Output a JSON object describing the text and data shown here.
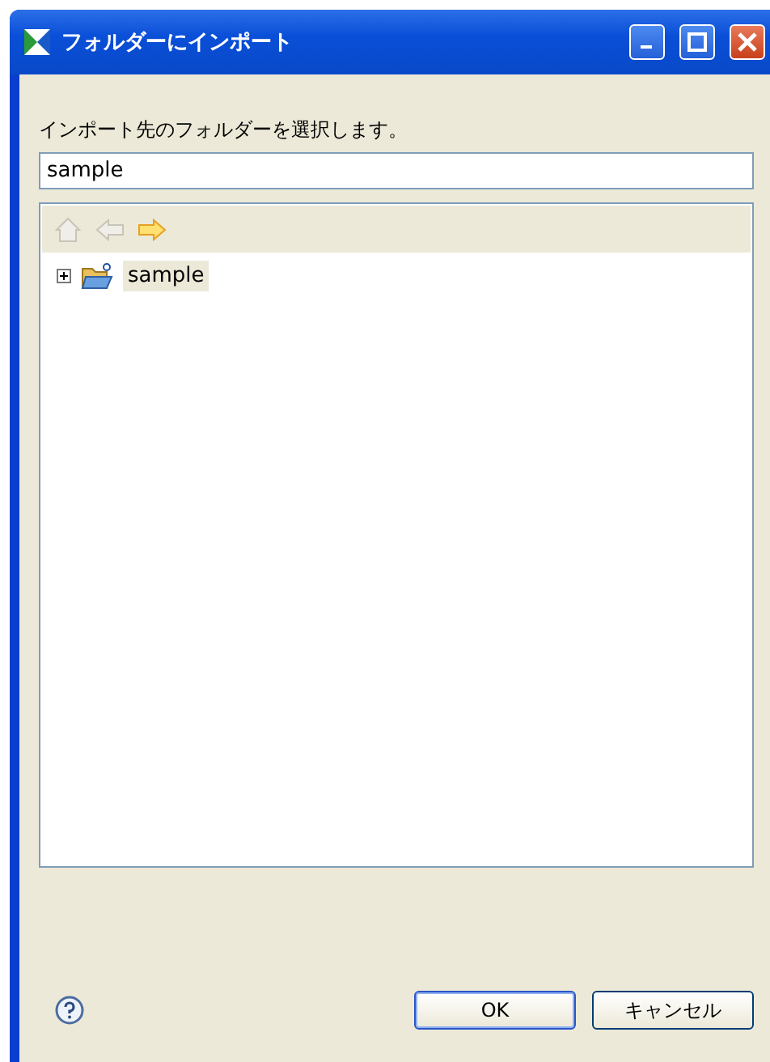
{
  "window": {
    "title": "フォルダーにインポート"
  },
  "prompt": "インポート先のフォルダーを選択します。",
  "folder_field": {
    "value": "sample"
  },
  "nav_buttons": [
    {
      "kind": "home",
      "disabled": true
    },
    {
      "kind": "back",
      "disabled": true
    },
    {
      "kind": "forward",
      "disabled": false
    }
  ],
  "tree": [
    {
      "label": "sample",
      "expanded": false,
      "selected": true
    }
  ],
  "buttons": [
    {
      "label": "OK",
      "default": true
    },
    {
      "label": "キャンセル",
      "default": false
    }
  ]
}
